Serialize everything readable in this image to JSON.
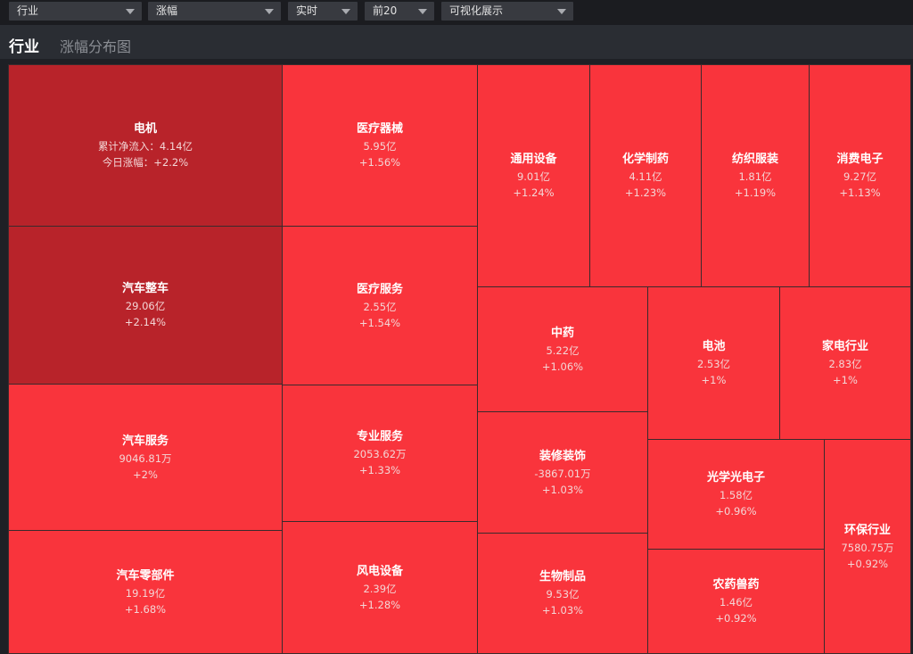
{
  "toolbar": {
    "select1": "行业",
    "select2": "涨幅",
    "select3": "实时",
    "select4": "前20",
    "select5": "可视化展示"
  },
  "header": {
    "title": "行业",
    "subtitle": "涨幅分布图"
  },
  "colors": {
    "dark_red": "#b8232a",
    "red": "#f9343c",
    "border": "#3a2a2c"
  },
  "tiles": [
    {
      "name": "电机",
      "flow": "累计净流入：4.14亿",
      "change": "今日涨幅：+2.2%"
    },
    {
      "name": "汽车整车",
      "flow": "29.06亿",
      "change": "+2.14%"
    },
    {
      "name": "汽车服务",
      "flow": "9046.81万",
      "change": "+2%"
    },
    {
      "name": "汽车零部件",
      "flow": "19.19亿",
      "change": "+1.68%"
    },
    {
      "name": "医疗器械",
      "flow": "5.95亿",
      "change": "+1.56%"
    },
    {
      "name": "医疗服务",
      "flow": "2.55亿",
      "change": "+1.54%"
    },
    {
      "name": "专业服务",
      "flow": "2053.62万",
      "change": "+1.33%"
    },
    {
      "name": "风电设备",
      "flow": "2.39亿",
      "change": "+1.28%"
    },
    {
      "name": "通用设备",
      "flow": "9.01亿",
      "change": "+1.24%"
    },
    {
      "name": "化学制药",
      "flow": "4.11亿",
      "change": "+1.23%"
    },
    {
      "name": "纺织服装",
      "flow": "1.81亿",
      "change": "+1.19%"
    },
    {
      "name": "消费电子",
      "flow": "9.27亿",
      "change": "+1.13%"
    },
    {
      "name": "中药",
      "flow": "5.22亿",
      "change": "+1.06%"
    },
    {
      "name": "电池",
      "flow": "2.53亿",
      "change": "+1%"
    },
    {
      "name": "家电行业",
      "flow": "2.83亿",
      "change": "+1%"
    },
    {
      "name": "装修装饰",
      "flow": "-3867.01万",
      "change": "+1.03%"
    },
    {
      "name": "生物制品",
      "flow": "9.53亿",
      "change": "+1.03%"
    },
    {
      "name": "光学光电子",
      "flow": "1.58亿",
      "change": "+0.96%"
    },
    {
      "name": "农药兽药",
      "flow": "1.46亿",
      "change": "+0.92%"
    },
    {
      "name": "环保行业",
      "flow": "7580.75万",
      "change": "+0.92%"
    }
  ]
}
